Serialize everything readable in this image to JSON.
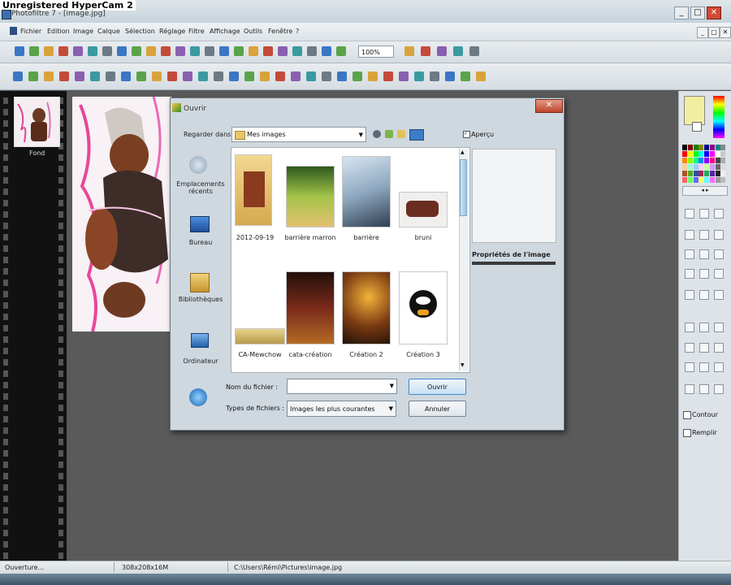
{
  "watermark": "Unregistered HyperCam 2",
  "app": {
    "title": "Photofiltre 7 - [image.jpg]"
  },
  "window_controls": {
    "minimize": "_",
    "maximize": "□",
    "close": "✕"
  },
  "menu": {
    "items": [
      "Fichier",
      "Edition",
      "Image",
      "Calque",
      "Sélection",
      "Réglage",
      "Filtre",
      "Affichage",
      "Outils",
      "Fenêtre",
      "?"
    ],
    "mdi_controls": [
      "_",
      "□",
      "✕"
    ]
  },
  "toolbar": {
    "zoom": "100%"
  },
  "thumbnail": {
    "label": "Fond"
  },
  "dialog": {
    "title": "Ouvrir",
    "close": "✕",
    "look_in_label": "Regarder dans :",
    "look_in_value": "Mes images",
    "places": [
      "Emplacements récents",
      "Bureau",
      "Bibliothèques",
      "Ordinateur"
    ],
    "files": [
      "2012-09-19",
      "barrière marron",
      "barrière",
      "bruni",
      "CA-Mewchow",
      "cata-création",
      "Création 2",
      "Création 3"
    ],
    "preview_label": "Aperçu",
    "properties_title": "Propriétés de l'image",
    "filename_label": "Nom du fichier :",
    "filename_value": "",
    "filetype_label": "Types de fichiers :",
    "filetype_value": "Images les plus courantes",
    "open_button": "Ouvrir",
    "cancel_button": "Annuler"
  },
  "right_panel": {
    "outline_label": "Contour",
    "fill_label": "Remplir"
  },
  "status": {
    "left": "Ouverture...",
    "size": "308x208x16M",
    "path": "C:\\Users\\Rémi\\Pictures\\image.jpg"
  },
  "colors": {
    "primary": "#f2eea0",
    "secondary": "#ffffff"
  }
}
